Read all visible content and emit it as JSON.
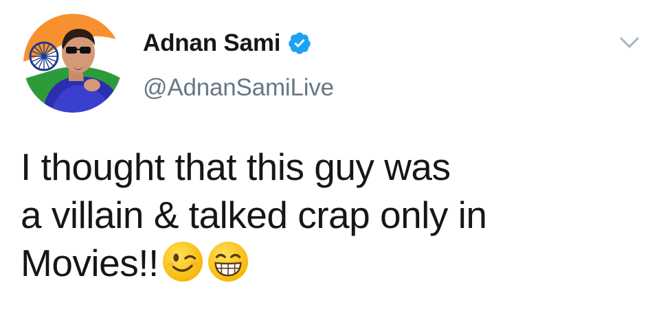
{
  "author": {
    "display_name": "Adnan Sami",
    "handle": "@AdnanSamiLive",
    "verified": true,
    "avatar_icon": "profile-photo-indian-flag-background"
  },
  "menu": {
    "icon": "chevron-down-icon"
  },
  "tweet": {
    "lines": [
      "I thought that this guy was",
      "a villain & talked crap only in",
      "Movies!!"
    ],
    "emojis": [
      "winking-face-emoji",
      "grinning-face-emoji"
    ]
  },
  "colors": {
    "name": "#14171a",
    "handle": "#657786",
    "verified_badge": "#1da1f2",
    "chevron": "#aab8c2"
  }
}
